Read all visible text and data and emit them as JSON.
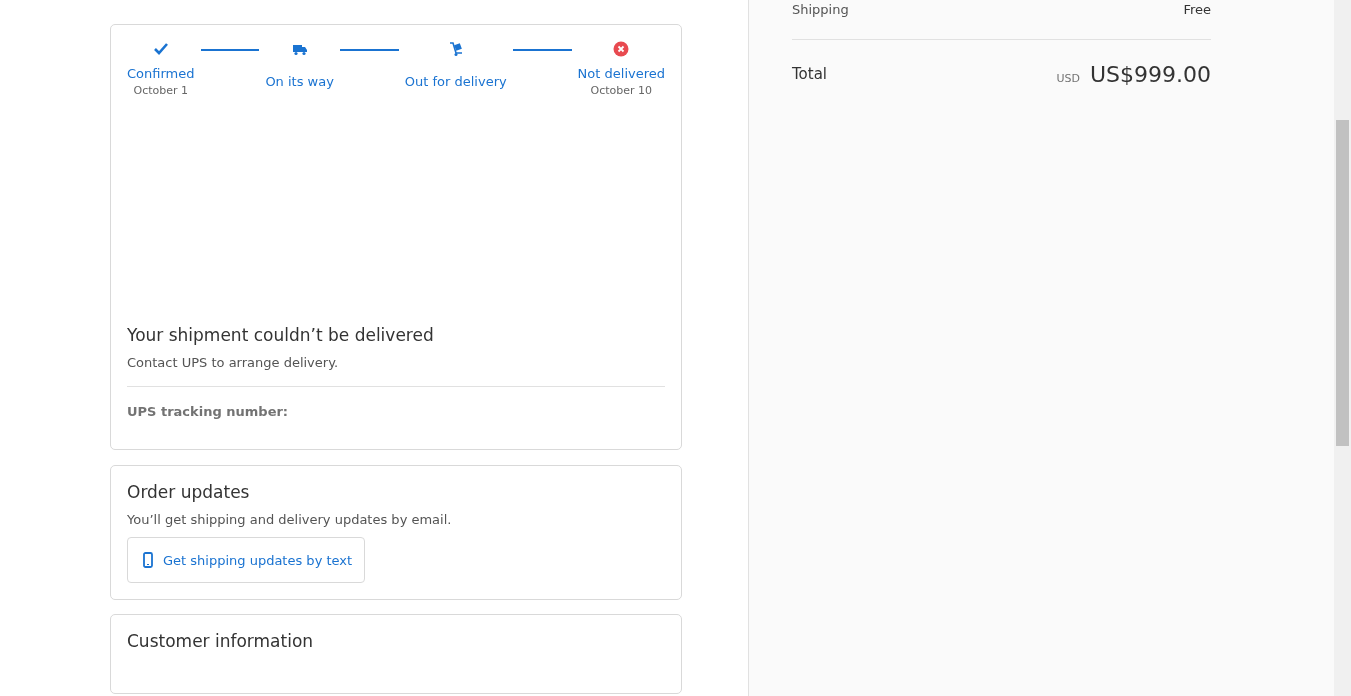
{
  "tracking": {
    "steps": [
      {
        "kind": "confirmed",
        "label": "Confirmed",
        "date": "October 1"
      },
      {
        "kind": "shipped",
        "label": "On its way"
      },
      {
        "kind": "out",
        "label": "Out for delivery"
      },
      {
        "kind": "failed",
        "label": "Not delivered",
        "date": "October 10"
      }
    ],
    "title": "Your shipment couldn’t be delivered",
    "message": "Contact UPS to arrange delivery.",
    "tracking_label": "UPS tracking number:"
  },
  "order_updates": {
    "title": "Order updates",
    "message": "You’ll get shipping and delivery updates by email.",
    "button": "Get shipping updates by text"
  },
  "customer_information": {
    "title": "Customer information"
  },
  "summary": {
    "shipping_label": "Shipping",
    "shipping_value": "Free",
    "total_label": "Total",
    "currency": "USD",
    "total": "US$999.00"
  }
}
